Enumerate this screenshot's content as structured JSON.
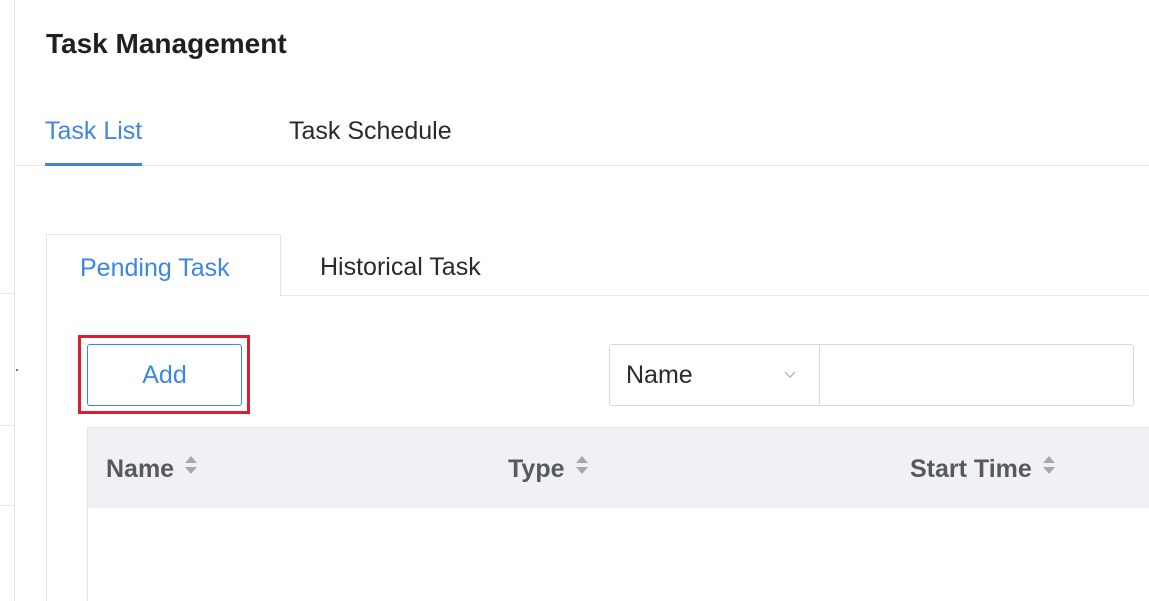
{
  "page": {
    "title": "Task Management"
  },
  "top_tabs": [
    {
      "label": "Task List",
      "active": true
    },
    {
      "label": "Task Schedule",
      "active": false
    }
  ],
  "sub_tabs": [
    {
      "label": "Pending Task",
      "active": true
    },
    {
      "label": "Historical Task",
      "active": false
    }
  ],
  "toolbar": {
    "add_label": "Add",
    "filter_field": {
      "selected": "Name",
      "icon": "chevron-down-icon"
    },
    "search": {
      "value": "",
      "placeholder": ""
    }
  },
  "table": {
    "columns": [
      {
        "label": "Name",
        "icon": "sort-icon"
      },
      {
        "label": "Type",
        "icon": "sort-icon"
      },
      {
        "label": "Start Time",
        "icon": "sort-icon"
      }
    ],
    "rows": []
  },
  "colors": {
    "accent": "#3c86e6",
    "highlight": "#d9202e",
    "header_bg": "#f0f1f5",
    "border": "#e8e8e8"
  }
}
